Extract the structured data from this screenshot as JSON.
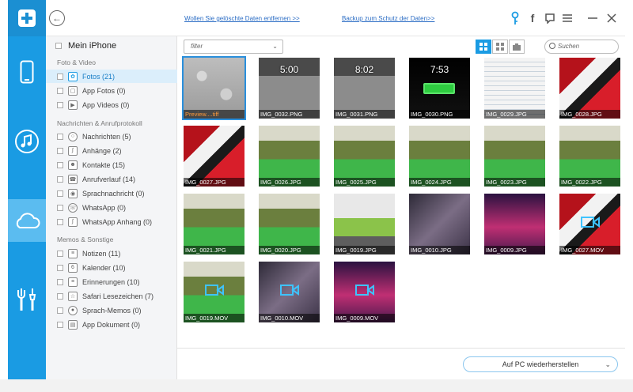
{
  "header": {
    "link_delete": "Wollen Sie gelöschte Daten entfernen >>",
    "link_backup": "Backup zum Schutz der Daten>>",
    "icons": [
      "key-icon",
      "facebook-icon",
      "feedback-icon",
      "menu-icon",
      "minimize-icon",
      "close-icon"
    ]
  },
  "sidebar": {
    "device": "Mein iPhone",
    "sections": [
      {
        "title": "Foto & Video",
        "items": [
          "Fotos (21)",
          "App Fotos (0)",
          "App Videos (0)"
        ]
      },
      {
        "title": "Nachrichten & Anrufprotokoll",
        "items": [
          "Nachrichten (5)",
          "Anhänge (2)",
          "Kontakte (15)",
          "Anrufverlauf (14)",
          "Sprachnachricht (0)",
          "WhatsApp (0)",
          "WhatsApp Anhang (0)"
        ]
      },
      {
        "title": "Memos & Sonstige",
        "items": [
          "Notizen (11)",
          "Kalender (10)",
          "Erinnerungen (10)",
          "Safari Lesezeichen (7)",
          "Sprach-Memos (0)",
          "App Dokument (0)"
        ]
      }
    ]
  },
  "toolbar": {
    "filter_placeholder": "filter",
    "search_placeholder": "Suchen"
  },
  "thumbnails": [
    {
      "name": "Preview....tiff",
      "kind": "drops"
    },
    {
      "name": "IMG_0032.PNG",
      "kind": "lock",
      "clock": "5:00"
    },
    {
      "name": "IMG_0031.PNG",
      "kind": "lock",
      "clock": "8:02"
    },
    {
      "name": "IMG_0030.PNG",
      "kind": "battery",
      "clock": "7:53"
    },
    {
      "name": "IMG_0029.JPG",
      "kind": "doc"
    },
    {
      "name": "IMG_0028.JPG",
      "kind": "poster"
    },
    {
      "name": "IMG_0027.JPG",
      "kind": "poster"
    },
    {
      "name": "IMG_0026.JPG",
      "kind": "green"
    },
    {
      "name": "IMG_0025.JPG",
      "kind": "green"
    },
    {
      "name": "IMG_0024.JPG",
      "kind": "green"
    },
    {
      "name": "IMG_0023.JPG",
      "kind": "green"
    },
    {
      "name": "IMG_0022.JPG",
      "kind": "green"
    },
    {
      "name": "IMG_0021.JPG",
      "kind": "green"
    },
    {
      "name": "IMG_0020.JPG",
      "kind": "green"
    },
    {
      "name": "IMG_0019.JPG",
      "kind": "office"
    },
    {
      "name": "IMG_0010.JPG",
      "kind": "blur"
    },
    {
      "name": "IMG_0009.JPG",
      "kind": "stage"
    },
    {
      "name": "IMG_0027.MOV",
      "kind": "poster",
      "video": true
    },
    {
      "name": "IMG_0019.MOV",
      "kind": "green",
      "video": true
    },
    {
      "name": "IMG_0010.MOV",
      "kind": "blur",
      "video": true
    },
    {
      "name": "IMG_0009.MOV",
      "kind": "stage",
      "video": true
    }
  ],
  "footer": {
    "restore_label": "Auf PC wiederherstellen"
  },
  "colors": {
    "accent": "#1a9be3",
    "selected": "#2a8fdc"
  }
}
